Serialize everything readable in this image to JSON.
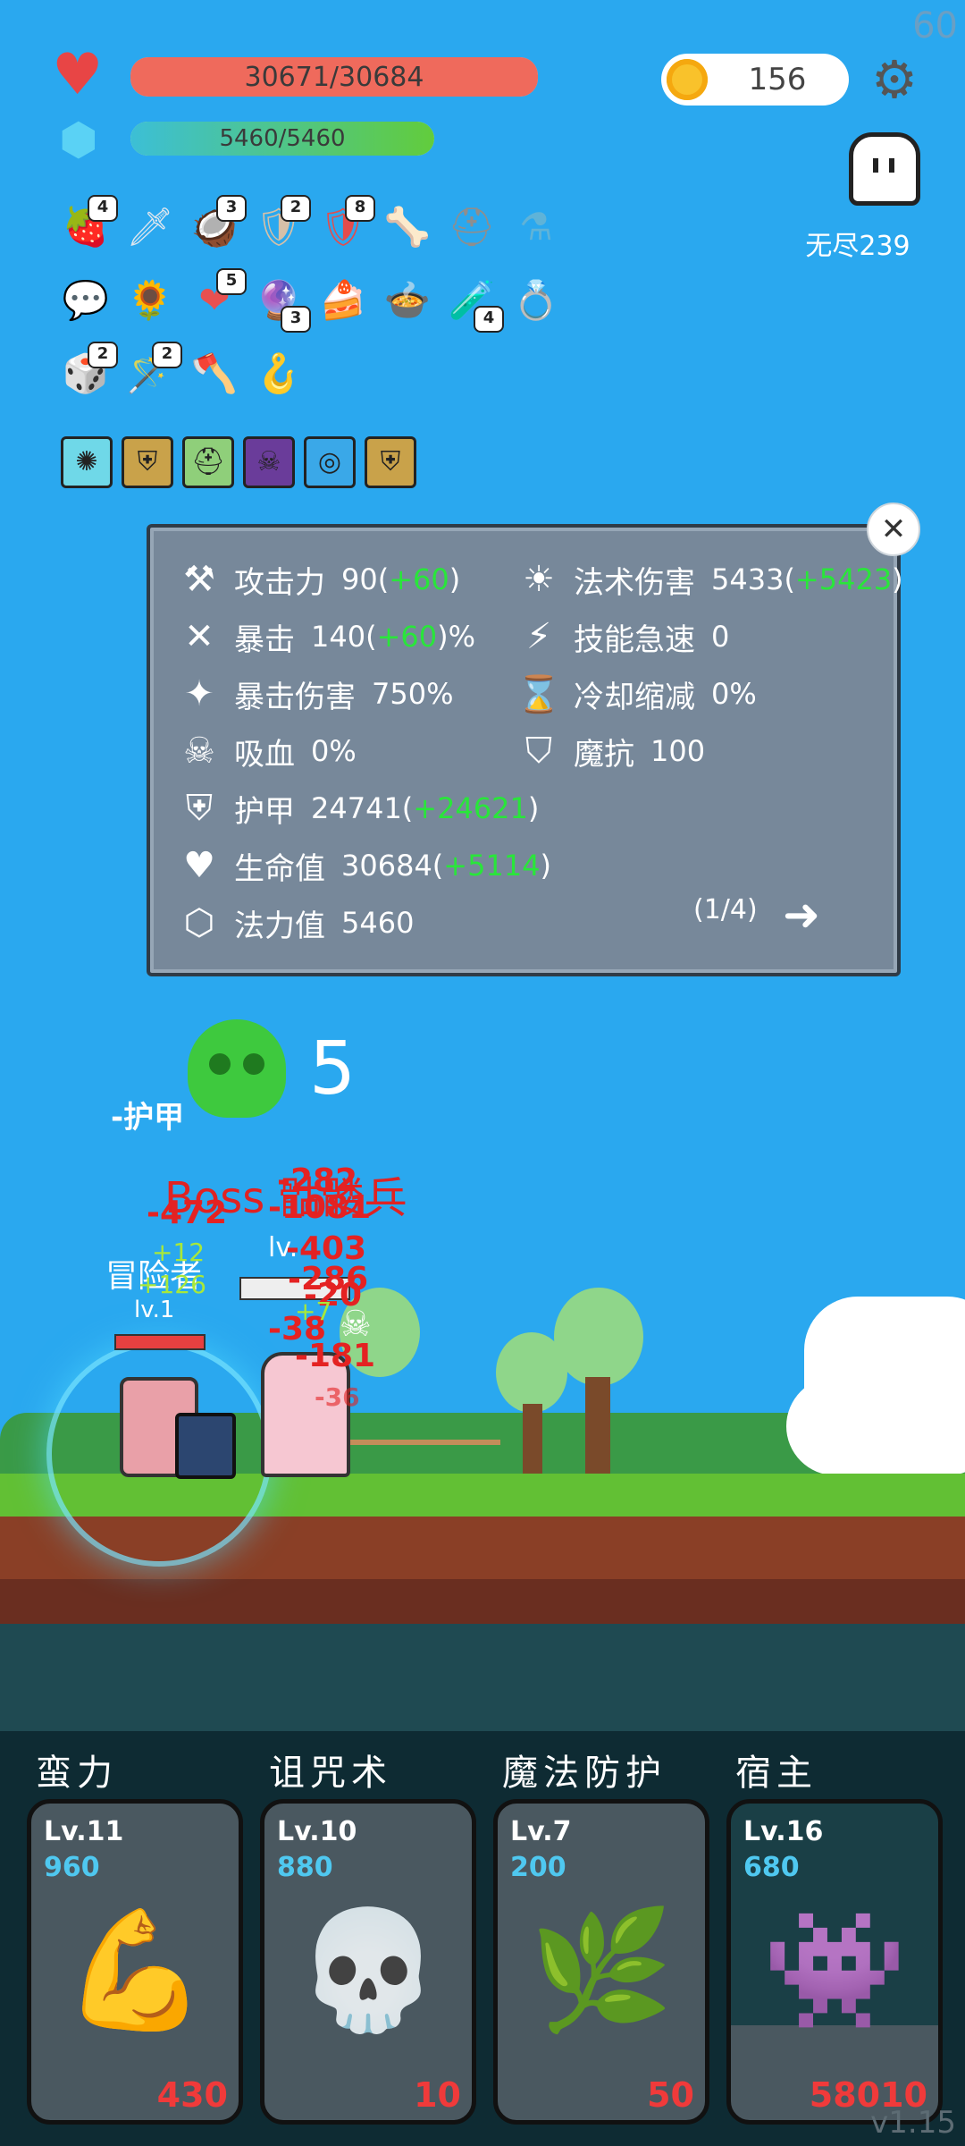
{
  "hud": {
    "fps": "60",
    "hp_text": "30671/30684",
    "hp_fraction": 0.9996,
    "mp_text": "5460/5460",
    "mp_fraction": 1.0,
    "coins": "156",
    "mode_label": "无尽239",
    "version": "v1.15"
  },
  "items": [
    {
      "icon": "jam-jar-icon",
      "glyph": "🍓",
      "count": "4"
    },
    {
      "icon": "sword-icon",
      "glyph": "🗡",
      "count": ""
    },
    {
      "icon": "coconut-icon",
      "glyph": "🥥",
      "count": "3"
    },
    {
      "icon": "round-shield-icon",
      "glyph": "🛡",
      "count": "2"
    },
    {
      "icon": "red-shield-icon",
      "glyph": "🛡",
      "count": "8"
    },
    {
      "icon": "bone-icon",
      "glyph": "🦴",
      "count": ""
    },
    {
      "icon": "helmet-icon",
      "glyph": "⛑",
      "count": ""
    },
    {
      "icon": "potion-icon",
      "glyph": "⚗",
      "count": ""
    },
    {
      "icon": "speech-bubble-icon",
      "glyph": "💬",
      "count": ""
    },
    {
      "icon": "sunflower-icon",
      "glyph": "🌻",
      "count": ""
    },
    {
      "icon": "hearts-icon",
      "glyph": "❤",
      "count": "5"
    },
    {
      "icon": "crystal-ball-icon",
      "glyph": "🔮",
      "count": "3"
    },
    {
      "icon": "flag-cake-icon",
      "glyph": "🍰",
      "count": ""
    },
    {
      "icon": "cauldron-icon",
      "glyph": "🍲",
      "count": ""
    },
    {
      "icon": "green-figure-icon",
      "glyph": "🧪",
      "count": "4"
    },
    {
      "icon": "ring-icon",
      "glyph": "💍",
      "count": ""
    },
    {
      "icon": "dice-icon",
      "glyph": "🎲",
      "count": "2"
    },
    {
      "icon": "magic-wand-icon",
      "glyph": "🪄",
      "count": "2"
    },
    {
      "icon": "battle-axe-icon",
      "glyph": "🪓",
      "count": ""
    },
    {
      "icon": "hook-icon",
      "glyph": "🪝",
      "count": ""
    }
  ],
  "runes": [
    {
      "icon": "light-rune-icon",
      "glyph": "✺",
      "color": "#6fd8e8"
    },
    {
      "icon": "shield-rune-icon",
      "glyph": "⛨",
      "color": "#c9a24a"
    },
    {
      "icon": "helmet-rune-icon",
      "glyph": "⛑",
      "color": "#8fcf7a"
    },
    {
      "icon": "demon-rune-icon",
      "glyph": "☠",
      "color": "#6a3c9a"
    },
    {
      "icon": "vortex-rune-icon",
      "glyph": "◎",
      "color": "#3aa8e8"
    },
    {
      "icon": "armor-rune-icon",
      "glyph": "⛨",
      "color": "#c9a24a"
    }
  ],
  "stats": {
    "left": [
      {
        "icon": "axe-icon",
        "glyph": "⚒",
        "label": "攻击力",
        "value": "90",
        "bonus": "+60",
        "suffix": ""
      },
      {
        "icon": "crit-icon",
        "glyph": "✕",
        "label": "暴击",
        "value": "140",
        "bonus": "+60",
        "suffix": "%"
      },
      {
        "icon": "crit-damage-icon",
        "glyph": "✦",
        "label": "暴击伤害",
        "value": "750%",
        "bonus": "",
        "suffix": ""
      },
      {
        "icon": "lifesteal-icon",
        "glyph": "☠",
        "label": "吸血",
        "value": "0%",
        "bonus": "",
        "suffix": ""
      },
      {
        "icon": "armor-icon",
        "glyph": "⛨",
        "label": "护甲",
        "value": "24741",
        "bonus": "+24621",
        "suffix": ""
      },
      {
        "icon": "heart-icon",
        "glyph": "♥",
        "label": "生命值",
        "value": "30684",
        "bonus": "+5114",
        "suffix": ""
      },
      {
        "icon": "mana-icon",
        "glyph": "⬡",
        "label": "法力值",
        "value": "5460",
        "bonus": "",
        "suffix": ""
      }
    ],
    "right": [
      {
        "icon": "sun-icon",
        "glyph": "☀",
        "label": "法术伤害",
        "value": "5433",
        "bonus": "+5423",
        "suffix": ""
      },
      {
        "icon": "lightning-icon",
        "glyph": "⚡",
        "label": "技能急速",
        "value": "0",
        "bonus": "",
        "suffix": ""
      },
      {
        "icon": "hourglass-icon",
        "glyph": "⌛",
        "label": "冷却缩减",
        "value": "0%",
        "bonus": "",
        "suffix": ""
      },
      {
        "icon": "magic-resist-icon",
        "glyph": "⛉",
        "label": "魔抗",
        "value": "100",
        "bonus": "",
        "suffix": ""
      }
    ],
    "page": "(1/4)"
  },
  "battle": {
    "kill_count": "5",
    "armor_popup": "-护甲",
    "boss_name": "Boss 骷髅兵",
    "boss_level": "lv.",
    "player_name": "冒险者",
    "player_level": "lv.1",
    "damage_numbers": [
      "-282",
      "-1081",
      "-472",
      "-403",
      "-286",
      "-20",
      "-38",
      "-181",
      "-36"
    ],
    "heal_numbers": [
      "+12",
      "+126",
      "+7"
    ]
  },
  "skills": [
    {
      "title": "蛮力",
      "level": "Lv.11",
      "cost": "960",
      "icon": "muscle-arm-icon",
      "glyph": "💪",
      "value": "430"
    },
    {
      "title": "诅咒术",
      "level": "Lv.10",
      "cost": "880",
      "icon": "skull-icon",
      "glyph": "💀",
      "value": "10"
    },
    {
      "title": "魔法防护",
      "level": "Lv.7",
      "cost": "200",
      "icon": "leaf-icon",
      "glyph": "🌿",
      "value": "50"
    },
    {
      "title": "宿主",
      "level": "Lv.16",
      "cost": "680",
      "icon": "eyeball-monster-icon",
      "glyph": "👾",
      "value": "58010"
    }
  ]
}
